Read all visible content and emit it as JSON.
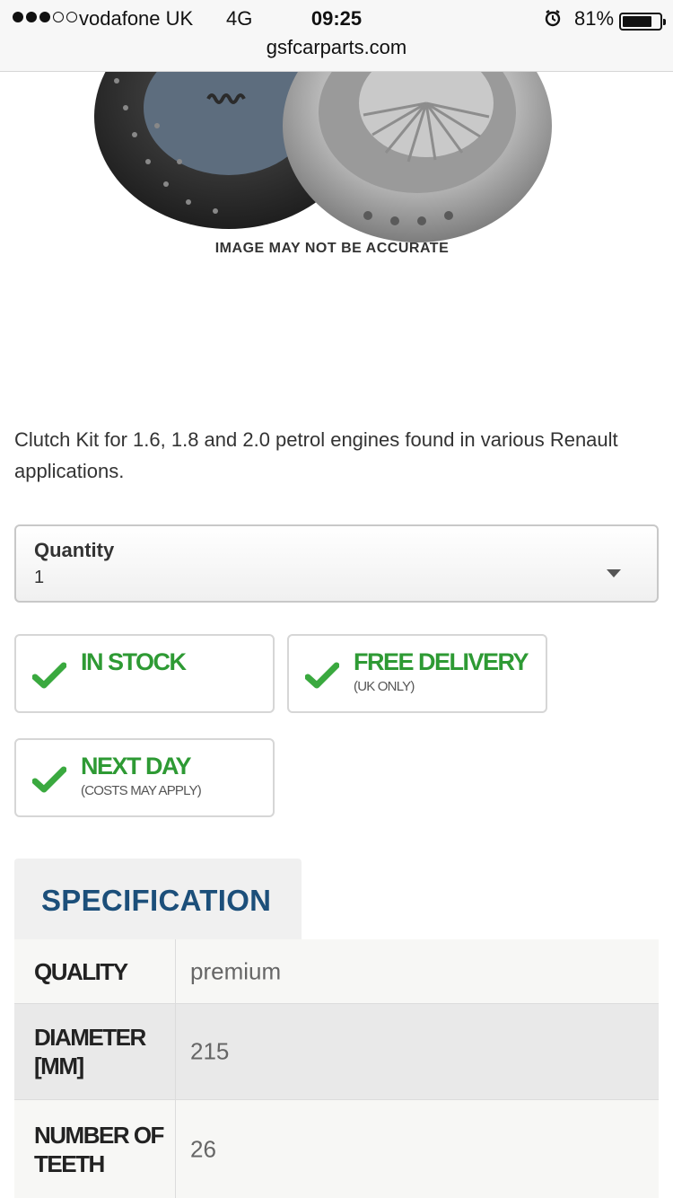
{
  "status_bar": {
    "signal_dots": "●●●○○",
    "carrier": "vodafone UK",
    "network": "4G",
    "time": "09:25",
    "battery_percent": "81%",
    "battery_level": 0.81
  },
  "browser": {
    "url": "gsfcarparts.com"
  },
  "product_image": {
    "icon": "clutch-kit-image",
    "caption": "IMAGE MAY NOT BE ACCURATE"
  },
  "description": "Clutch Kit for 1.6, 1.8 and 2.0 petrol engines found in various Renault applications.",
  "quantity": {
    "label": "Quantity",
    "value": "1"
  },
  "badges": [
    {
      "title": "IN STOCK",
      "subtitle": ""
    },
    {
      "title": "FREE DELIVERY",
      "subtitle": "(UK ONLY)"
    },
    {
      "title": "NEXT DAY",
      "subtitle": "(COSTS MAY APPLY)"
    }
  ],
  "specification": {
    "heading": "SPECIFICATION",
    "rows": [
      {
        "key": "QUALITY",
        "value": "premium"
      },
      {
        "key": "DIAMETER [MM]",
        "value": "215"
      },
      {
        "key": "NUMBER OF TEETH",
        "value": "26"
      }
    ]
  },
  "colors": {
    "accent_green": "#2e9a34",
    "spec_blue": "#1c4f7a"
  }
}
